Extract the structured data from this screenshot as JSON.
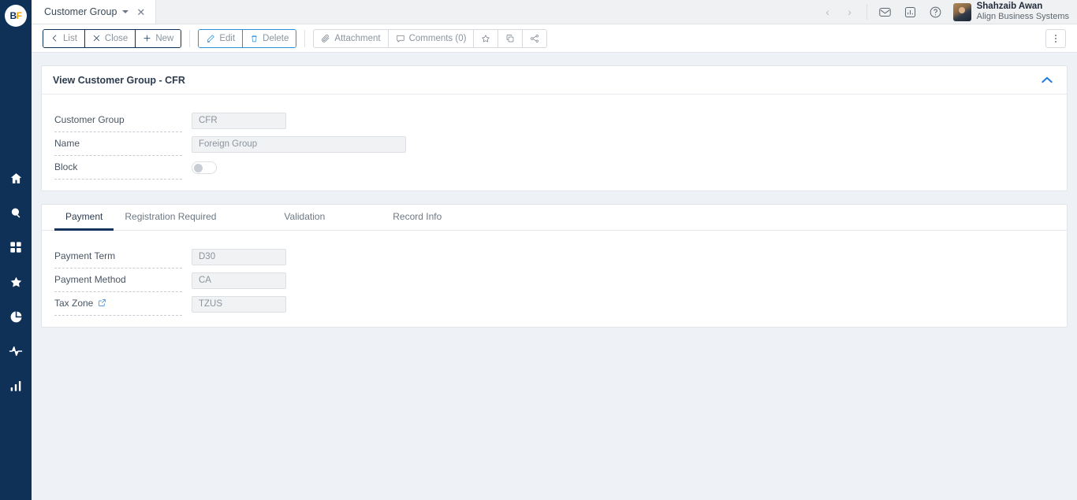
{
  "brand": {
    "logo_left": "B",
    "logo_right": "F",
    "navy": "#0f3057",
    "gold": "#f0a500",
    "accent_blue": "#1f7ae0"
  },
  "sidebar": {
    "items": [
      {
        "icon": "home-icon",
        "name": "home"
      },
      {
        "icon": "search-icon",
        "name": "search"
      },
      {
        "icon": "grid-icon",
        "name": "modules"
      },
      {
        "icon": "star-icon",
        "name": "favorites"
      },
      {
        "icon": "pie-chart-icon",
        "name": "reports"
      },
      {
        "icon": "activity-icon",
        "name": "activity"
      },
      {
        "icon": "bar-chart-icon",
        "name": "analytics"
      }
    ]
  },
  "tabstrip": {
    "tab_label": "Customer Group",
    "close_glyph": "✕",
    "prev_glyph": "‹",
    "next_glyph": "›",
    "icons": [
      {
        "name": "mail-icon"
      },
      {
        "name": "insights-icon"
      },
      {
        "name": "help-icon"
      }
    ]
  },
  "user": {
    "name": "Shahzaib Awan",
    "org": "Align Business Systems"
  },
  "toolbar": {
    "group_nav": [
      {
        "label": "List",
        "icon": "chevron-left-icon"
      },
      {
        "label": "Close",
        "icon": "close-icon"
      },
      {
        "label": "New",
        "icon": "plus-icon"
      }
    ],
    "group_edit": [
      {
        "label": "Edit",
        "icon": "pencil-icon"
      },
      {
        "label": "Delete",
        "icon": "trash-icon"
      }
    ],
    "group_misc": [
      {
        "label": "Attachment",
        "icon": "paperclip-icon"
      },
      {
        "label": "Comments (0)",
        "icon": "comment-icon"
      },
      {
        "label": "",
        "icon": "star-outline-icon"
      },
      {
        "label": "",
        "icon": "copy-icon"
      },
      {
        "label": "",
        "icon": "share-icon"
      }
    ],
    "overflow_name": "more-options-button"
  },
  "main_panel": {
    "title": "View Customer Group - CFR",
    "collapse_icon": "chevron-up-icon",
    "fields": [
      {
        "label": "Customer Group",
        "value": "CFR",
        "type": "text",
        "size": "sm"
      },
      {
        "label": "Name",
        "value": "Foreign Group",
        "type": "text",
        "size": "lg"
      },
      {
        "label": "Block",
        "value": "",
        "type": "toggle",
        "checked": false
      }
    ]
  },
  "detail_panel": {
    "tabs": [
      {
        "label": "Payment",
        "active": true
      },
      {
        "label": "Registration Required",
        "active": false
      },
      {
        "label": "Validation",
        "active": false
      },
      {
        "label": "Record Info",
        "active": false
      }
    ],
    "fields": [
      {
        "label": "Payment Term",
        "value": "D30",
        "type": "text",
        "size": "sm",
        "link_icon": false
      },
      {
        "label": "Payment Method",
        "value": "CA",
        "type": "text",
        "size": "sm",
        "link_icon": false
      },
      {
        "label": "Tax Zone",
        "value": "TZUS",
        "type": "text",
        "size": "sm",
        "link_icon": true,
        "link_icon_name": "external-link-icon"
      }
    ]
  }
}
